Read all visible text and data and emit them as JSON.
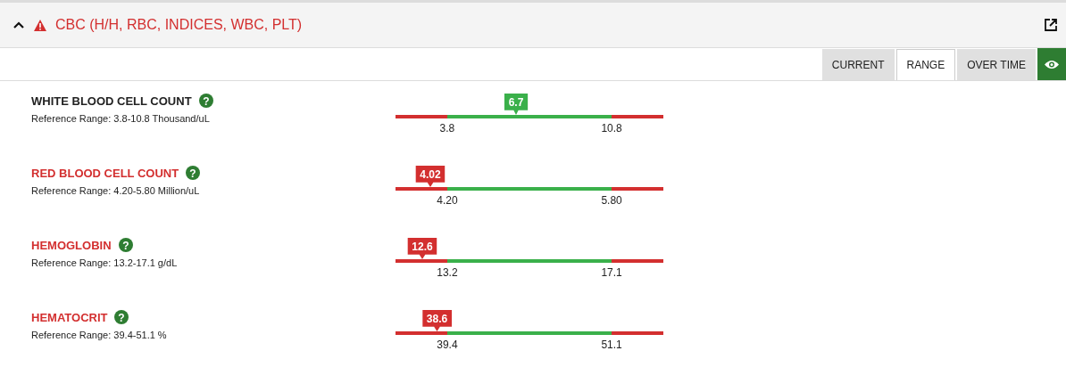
{
  "panel": {
    "title": "CBC (H/H, RBC, INDICES, WBC, PLT)",
    "expanded": true,
    "alert": true
  },
  "tabs": [
    {
      "label": "CURRENT",
      "selected": false
    },
    {
      "label": "RANGE",
      "selected": true
    },
    {
      "label": "OVER TIME",
      "selected": false
    }
  ],
  "rows": [
    {
      "help": "?",
      "name": "WHITE BLOOD CELL COUNT",
      "reference": "Reference Range: 3.8-10.8 Thousand/uL",
      "value": "6.7",
      "abnormal": false,
      "level": 0.45,
      "low": "3.8",
      "high": "10.8"
    },
    {
      "help": "?",
      "name": "RED BLOOD CELL COUNT",
      "reference": "Reference Range: 4.20-5.80 Million/uL",
      "value": "4.02",
      "abnormal": true,
      "level": 0.13,
      "low": "4.20",
      "high": "5.80"
    },
    {
      "help": "?",
      "name": "HEMOGLOBIN",
      "reference": "Reference Range: 13.2-17.1 g/dL",
      "value": "12.6",
      "abnormal": true,
      "level": 0.1,
      "low": "13.2",
      "high": "17.1"
    },
    {
      "help": "?",
      "name": "HEMATOCRIT",
      "reference": "Reference Range: 39.4-51.1 %",
      "value": "38.6",
      "abnormal": true,
      "level": 0.155,
      "low": "39.4",
      "high": "51.1"
    }
  ]
}
